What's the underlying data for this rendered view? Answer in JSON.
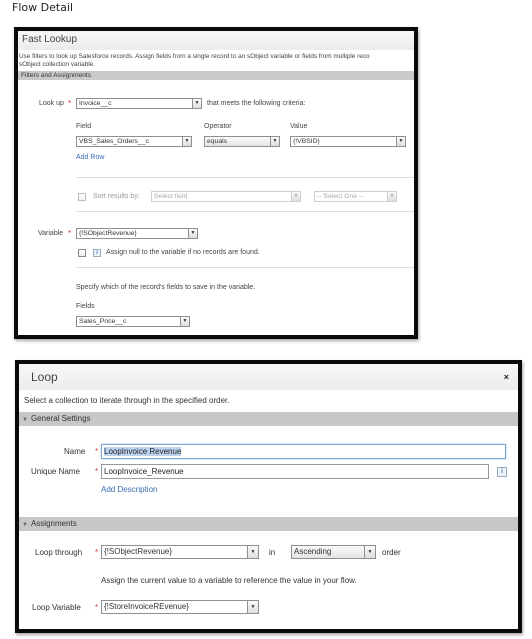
{
  "page_title": "Flow Detail",
  "fast_lookup": {
    "title": "Fast Lookup",
    "description_line1": "Use filters to look up Salesforce records. Assign fields from a single record to an sObject variable or fields from multiple reco",
    "description_line2": "sObject collection variable.",
    "section_title": "Filters and Assignments",
    "lookup_label": "Look up",
    "lookup_value": "Invoice__c",
    "criteria_text": "that meets the following criteria:",
    "col_field": "Field",
    "col_operator": "Operator",
    "col_value": "Value",
    "filter_row": {
      "field": "VBS_Sales_Orders__c",
      "operator": "equals",
      "value": "{!VBSID}"
    },
    "add_row": "Add Row",
    "sort_label": "Sort results by:",
    "sort_field_placeholder": "Select field",
    "sort_order_placeholder": "-- Select One --",
    "variable_label": "Variable",
    "variable_value": "{!SObjectRevenue}",
    "assign_null_text": "Assign null to the variable if no records are found.",
    "specify_text": "Specify which of the record's fields to save in the variable.",
    "fields_label": "Fields",
    "fields_value": "Sales_Price__c"
  },
  "loop": {
    "title": "Loop",
    "close_symbol": "×",
    "description": "Select a collection to iterate through in the specified order.",
    "general_settings": "General Settings",
    "name_label": "Name",
    "name_value": "LoopInvoice Revenue",
    "unique_name_label": "Unique Name",
    "unique_name_value": "LoopInvoice_Revenue",
    "add_description": "Add Description",
    "assignments": "Assignments",
    "loop_through_label": "Loop through",
    "loop_through_value": "{!SObjectRevenue}",
    "in_text": "in",
    "order_value": "Ascending",
    "order_text": "order",
    "assign_help": "Assign the current value to a variable to reference the value in your flow.",
    "loop_variable_label": "Loop Variable",
    "loop_variable_value": "{!StoreInvoiceREvenue}"
  },
  "symbols": {
    "required": "*",
    "dropdown": "▼",
    "collapse": "▼",
    "info": "i"
  }
}
